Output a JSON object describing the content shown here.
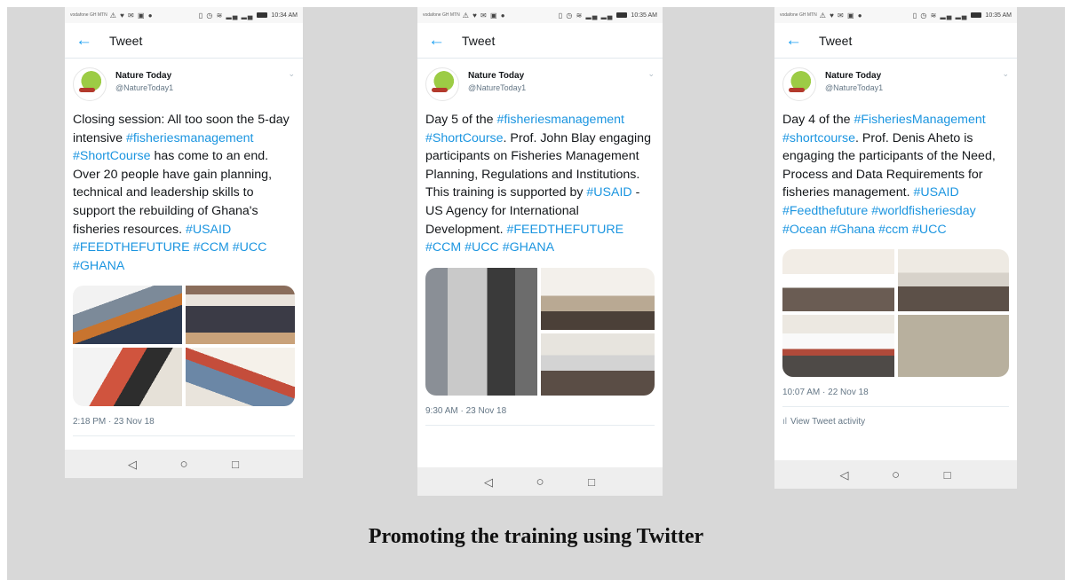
{
  "phones": [
    {
      "status": {
        "carrier": "vodafone GH MTN",
        "notif_icons": "⚠ ♥ ✉ ▣ ●",
        "signal_icons": "▯ ◷ ≋ ▂▄ ▂▄",
        "time": "10:34 AM"
      },
      "appbar_title": "Tweet",
      "author_name": "Nature Today",
      "author_handle": "@NatureToday1",
      "tweet_parts": [
        {
          "text": "Closing session: All too soon the 5-day intensive ",
          "tag": false
        },
        {
          "text": "#fisheriesmanagement",
          "tag": true
        },
        {
          "text": " ",
          "tag": false
        },
        {
          "text": "#ShortCourse",
          "tag": true
        },
        {
          "text": " has come to an end. Over 20 people have gain planning, technical and leadership skills to support the rebuilding of Ghana's fisheries resources. ",
          "tag": false
        },
        {
          "text": "#USAID",
          "tag": true
        },
        {
          "text": " ",
          "tag": false
        },
        {
          "text": "#FEEDTHEFUTURE",
          "tag": true
        },
        {
          "text": " ",
          "tag": false
        },
        {
          "text": "#CCM",
          "tag": true
        },
        {
          "text": " ",
          "tag": false
        },
        {
          "text": "#UCC",
          "tag": true
        },
        {
          "text": " ",
          "tag": false
        },
        {
          "text": "#GHANA",
          "tag": true
        }
      ],
      "timestamp": "2:18 PM · 23 Nov 18"
    },
    {
      "status": {
        "carrier": "vodafone GH MTN",
        "notif_icons": "⚠ ♥ ✉ ▣ ●",
        "signal_icons": "▯ ◷ ≋ ▂▄ ▂▄",
        "time": "10:35 AM"
      },
      "appbar_title": "Tweet",
      "author_name": "Nature Today",
      "author_handle": "@NatureToday1",
      "tweet_parts": [
        {
          "text": "Day 5 of the ",
          "tag": false
        },
        {
          "text": "#fisheriesmanagement",
          "tag": true
        },
        {
          "text": " ",
          "tag": false
        },
        {
          "text": "#ShortCourse",
          "tag": true
        },
        {
          "text": ". Prof. John Blay engaging participants on Fisheries Management Planning, Regulations and Institutions. This training is supported by ",
          "tag": false
        },
        {
          "text": "#USAID",
          "tag": true
        },
        {
          "text": " - US Agency for International Development. ",
          "tag": false
        },
        {
          "text": "#FEEDTHEFUTURE",
          "tag": true
        },
        {
          "text": " ",
          "tag": false
        },
        {
          "text": "#CCM",
          "tag": true
        },
        {
          "text": " ",
          "tag": false
        },
        {
          "text": "#UCC",
          "tag": true
        },
        {
          "text": " ",
          "tag": false
        },
        {
          "text": "#GHANA",
          "tag": true
        }
      ],
      "timestamp": "9:30 AM · 23 Nov 18"
    },
    {
      "status": {
        "carrier": "vodafone GH MTN",
        "notif_icons": "⚠ ♥ ✉ ▣ ●",
        "signal_icons": "▯ ◷ ≋ ▂▄ ▂▄",
        "time": "10:35 AM"
      },
      "appbar_title": "Tweet",
      "author_name": "Nature Today",
      "author_handle": "@NatureToday1",
      "tweet_parts": [
        {
          "text": "Day 4 of the ",
          "tag": false
        },
        {
          "text": "#FisheriesManagement",
          "tag": true
        },
        {
          "text": " ",
          "tag": false
        },
        {
          "text": "#shortcourse",
          "tag": true
        },
        {
          "text": ". Prof. Denis Aheto is engaging the participants of the Need, Process and Data Requirements for fisheries management.  ",
          "tag": false
        },
        {
          "text": "#USAID",
          "tag": true
        },
        {
          "text": " ",
          "tag": false
        },
        {
          "text": "#Feedthefuture",
          "tag": true
        },
        {
          "text": " ",
          "tag": false
        },
        {
          "text": "#worldfisheriesday",
          "tag": true
        },
        {
          "text": " ",
          "tag": false
        },
        {
          "text": "#Ocean",
          "tag": true
        },
        {
          "text": " ",
          "tag": false
        },
        {
          "text": "#Ghana",
          "tag": true
        },
        {
          "text": " ",
          "tag": false
        },
        {
          "text": "#ccm",
          "tag": true
        },
        {
          "text": " ",
          "tag": false
        },
        {
          "text": "#UCC",
          "tag": true
        }
      ],
      "timestamp": "10:07 AM · 22 Nov 18",
      "activity_label": "View Tweet activity"
    }
  ],
  "icons": {
    "back": "back-arrow-icon",
    "chevron": "chevron-down-icon",
    "activity": "bar-chart-icon",
    "nav_back": "triangle-back-icon",
    "nav_home": "circle-home-icon",
    "nav_recent": "square-recent-icon"
  },
  "glyphs": {
    "back": "←",
    "chevron": "⌄",
    "activity": "ıl",
    "nav_back": "◁",
    "nav_home": "○",
    "nav_recent": "□"
  },
  "caption": "Promoting the training using Twitter"
}
